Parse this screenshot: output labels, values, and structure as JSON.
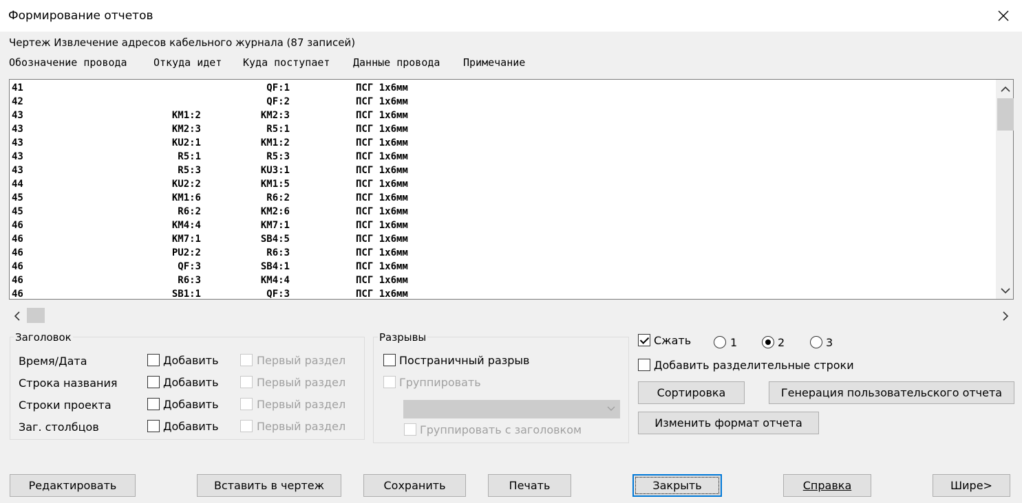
{
  "window": {
    "title": "Формирование отчетов"
  },
  "caption": "Чертеж Извлечение адресов кабельного журнала (87 записей)",
  "columns": [
    "Обозначение провода",
    "Откуда идет",
    "Куда поступает",
    "Данные провода",
    "Примечание"
  ],
  "rows": [
    {
      "wire": "41",
      "from": "",
      "to": "QF:1",
      "data": "ПСГ 1x6мм"
    },
    {
      "wire": "42",
      "from": "",
      "to": "QF:2",
      "data": "ПСГ 1x6мм"
    },
    {
      "wire": "43",
      "from": "KM1:2",
      "to": "KM2:3",
      "data": "ПСГ 1x6мм"
    },
    {
      "wire": "43",
      "from": "KM2:3",
      "to": "R5:1",
      "data": "ПСГ 1x6мм"
    },
    {
      "wire": "43",
      "from": "KU2:1",
      "to": "KM1:2",
      "data": "ПСГ 1x6мм"
    },
    {
      "wire": "43",
      "from": "R5:1",
      "to": "R5:3",
      "data": "ПСГ 1x6мм"
    },
    {
      "wire": "43",
      "from": "R5:3",
      "to": "KU3:1",
      "data": "ПСГ 1x6мм"
    },
    {
      "wire": "44",
      "from": "KU2:2",
      "to": "KM1:5",
      "data": "ПСГ 1x6мм"
    },
    {
      "wire": "45",
      "from": "KM1:6",
      "to": "R6:2",
      "data": "ПСГ 1x6мм"
    },
    {
      "wire": "45",
      "from": "R6:2",
      "to": "KM2:6",
      "data": "ПСГ 1x6мм"
    },
    {
      "wire": "46",
      "from": "KM4:4",
      "to": "KM7:1",
      "data": "ПСГ 1x6мм"
    },
    {
      "wire": "46",
      "from": "KM7:1",
      "to": "SB4:5",
      "data": "ПСГ 1x6мм"
    },
    {
      "wire": "46",
      "from": "PU2:2",
      "to": "R6:3",
      "data": "ПСГ 1x6мм"
    },
    {
      "wire": "46",
      "from": "QF:3",
      "to": "SB4:1",
      "data": "ПСГ 1x6мм"
    },
    {
      "wire": "46",
      "from": "R6:3",
      "to": "KM4:4",
      "data": "ПСГ 1x6мм"
    },
    {
      "wire": "46",
      "from": "SB1:1",
      "to": "QF:3",
      "data": "ПСГ 1x6мм"
    }
  ],
  "header_group": {
    "legend": "Заголовок",
    "rows": [
      {
        "label": "Время/Дата",
        "add": "Добавить",
        "first": "Первый раздел"
      },
      {
        "label": "Строка названия",
        "add": "Добавить",
        "first": "Первый раздел"
      },
      {
        "label": "Строки проекта",
        "add": "Добавить",
        "first": "Первый раздел"
      },
      {
        "label": "Заг. столбцов",
        "add": "Добавить",
        "first": "Первый раздел"
      }
    ]
  },
  "breaks_group": {
    "legend": "Разрывы",
    "page_break": "Постраничный разрыв",
    "group": "Группировать",
    "group_with_header": "Группировать с заголовком",
    "combo_value": ""
  },
  "options": {
    "compress": "Сжать",
    "compress_checked": true,
    "radios": [
      "1",
      "2",
      "3"
    ],
    "selected_radio": "2",
    "separator_rows": "Добавить разделительные строки",
    "sort_button": "Сортировка",
    "user_report_button": "Генерация пользовательского отчета",
    "change_format_button": "Изменить формат отчета"
  },
  "buttons": {
    "edit": "Редактировать",
    "insert": "Вставить в чертеж",
    "save": "Сохранить",
    "print": "Печать",
    "close": "Закрыть",
    "help": "Справка",
    "wider": "Шире>"
  }
}
